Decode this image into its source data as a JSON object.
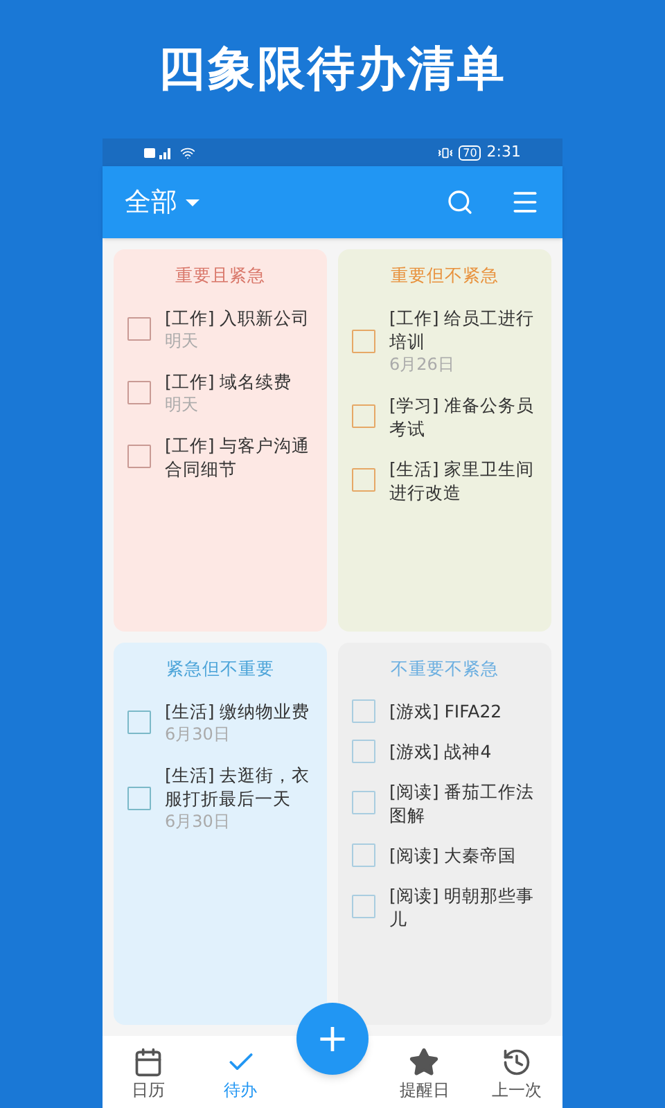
{
  "promo_title": "四象限待办清单",
  "status_bar": {
    "battery": "70",
    "time": "2:31"
  },
  "app_bar": {
    "title": "全部"
  },
  "quadrants": [
    {
      "title": "重要且紧急",
      "kind": "red",
      "color": "#d9776a",
      "items": [
        {
          "text": "[工作] 入职新公司",
          "date": "明天",
          "checked": false
        },
        {
          "text": "[工作] 域名续费",
          "date": "明天",
          "checked": false
        },
        {
          "text": "[工作] 与客户沟通合同细节",
          "checked": false
        }
      ]
    },
    {
      "title": "重要但不紧急",
      "kind": "olive",
      "color": "#e8913c",
      "items": [
        {
          "text": "[工作] 给员工进行培训",
          "date": "6月26日",
          "checked": false
        },
        {
          "text": "[学习] 准备公务员考试",
          "checked": false
        },
        {
          "text": "[生活] 家里卫生间进行改造",
          "checked": false
        }
      ]
    },
    {
      "title": "紧急但不重要",
      "kind": "blue",
      "color": "#4aa3d8",
      "items": [
        {
          "text": "[生活] 缴纳物业费",
          "date": "6月30日",
          "checked": false
        },
        {
          "text": "[生活] 去逛街，衣服打折最后一天",
          "date": "6月30日",
          "checked": false
        }
      ]
    },
    {
      "title": "不重要不紧急",
      "kind": "grey",
      "color": "#6aaee0",
      "items": [
        {
          "text": "[游戏] FIFA22",
          "checked": false
        },
        {
          "text": "[游戏] 战神4",
          "checked": false
        },
        {
          "text": "[阅读] 番茄工作法图解",
          "checked": false
        },
        {
          "text": "[阅读] 大秦帝国",
          "checked": false
        },
        {
          "text": "[阅读] 明朝那些事儿",
          "checked": false
        }
      ]
    }
  ],
  "bottom_nav": [
    {
      "kind": "calendar",
      "label": "日历",
      "selected": false
    },
    {
      "kind": "check",
      "label": "待办",
      "selected": true
    },
    {
      "kind": "fab",
      "label": "+"
    },
    {
      "kind": "star",
      "label": "提醒日",
      "selected": false
    },
    {
      "kind": "history",
      "label": "上一次",
      "selected": false
    }
  ]
}
